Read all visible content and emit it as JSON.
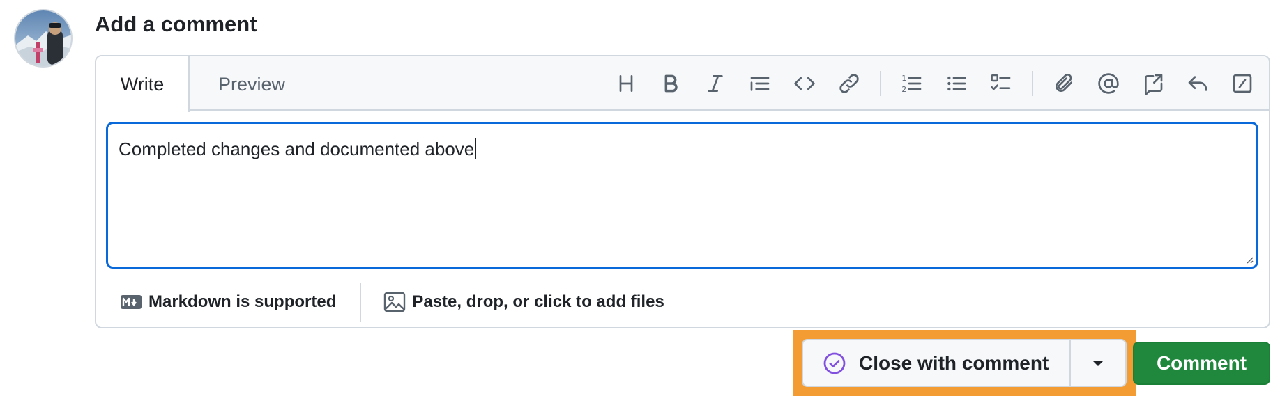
{
  "heading": "Add a comment",
  "tabs": {
    "write": "Write",
    "preview": "Preview"
  },
  "toolbar": [
    "heading",
    "bold",
    "italic",
    "quote",
    "code",
    "link",
    "numbered-list",
    "unordered-list",
    "task-list",
    "attach",
    "mention",
    "reference",
    "reply",
    "slash-commands"
  ],
  "comment": {
    "value": "Completed changes and documented above"
  },
  "footer": {
    "markdown": "Markdown is supported",
    "attach": "Paste, drop, or click to add files"
  },
  "actions": {
    "close_with_comment": "Close with comment",
    "comment": "Comment"
  },
  "colors": {
    "primary": "#1f883d",
    "focus": "#0969da",
    "highlight": "#f39c34",
    "closed_icon": "#8250df"
  }
}
